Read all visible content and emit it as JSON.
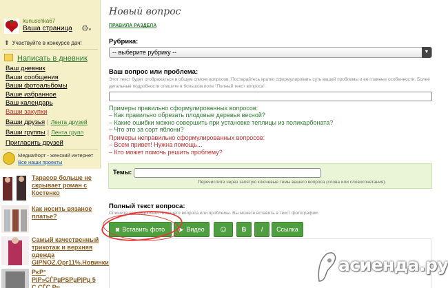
{
  "sidebar": {
    "username": "kunuschka67",
    "my_page": "Ваша страница",
    "contest": "Участвуйте в конкурсе дач!",
    "write_diary": "Написать в дневник",
    "nav": [
      "Ваш дневник",
      "Ваши сообщения",
      "Ваши фотоальбомы",
      "Ваше избранное",
      "Ваш календарь",
      "Ваши закупки"
    ],
    "friends": {
      "a": "Ваши друзья",
      "b": "Лента друзей"
    },
    "groups": {
      "a": "Ваши группы",
      "b": "Лента групп"
    },
    "invite": "Пригласить друзей",
    "mediafort_text": "МедиаФорт - женский интернет",
    "mediafort_link": "Все наши проекты",
    "news": [
      {
        "title": "Тарасов больше не скрывает роман с Костенко"
      },
      {
        "title": "Как носить вязаное платье?"
      },
      {
        "title": "Самый качественный трикотаж и верхняя одежда GIPNOZ.Орг11%.Новинки!"
      },
      {
        "title": "РєР° РiР»СЃРµРЅРµРјРµ 5 С,СЃС,Рµ"
      }
    ]
  },
  "main": {
    "title": "Новый вопрос",
    "rules_link": "ПРАВИЛА РАЗДЕЛА",
    "rubric_label": "Рубрика:",
    "rubric_value": "-- выберите рубрику --",
    "question_label": "Ваш вопрос или проблема:",
    "question_hint": "Этот текст будет отображаться в общем списке вопросов. Постарайтесь кратко сформулировать суть вашей проблемы и ее главные особенности. Более детальные подробности опишите в большом поле \"Полный текст вопроса\".",
    "good_head": "Примеры правильно сформулированных вопросов:",
    "good_examples": [
      "– Как правильно обрезать плодовые деревья весной?",
      "– Какие ошибки можно совершить при установке теплицы из поликарбоната?",
      "– Что это за сорт яблони?"
    ],
    "bad_head": "Примеры неправильно сформулированных вопросов:",
    "bad_examples": [
      "– Всем привет! Нужна помощь...",
      "– Кто может помочь решить проблему?"
    ],
    "themes_label": "Темы:",
    "themes_hint": "Перечислите через запятую ключевые темы вашего вопроса (слова или словосочетания).",
    "full_label": "Полный текст вопроса:",
    "full_hint": "Опишите все подробности вашего вопроса или проблемы. Вы можете вставить в текст фотографии.",
    "toolbar": {
      "photo": "Вставить фото",
      "video": "Видео",
      "smile": "☺",
      "bold": "B",
      "italic": "I",
      "link": "Ссылка"
    }
  },
  "watermark": "асиенда.ру",
  "colors": {
    "accent_green": "#4f9e3f",
    "link_green": "#2d7a2d",
    "error_red": "#c12d2d",
    "sidebar_bg": "#f6f0c8",
    "highlight_circle": "#e33a3a"
  }
}
